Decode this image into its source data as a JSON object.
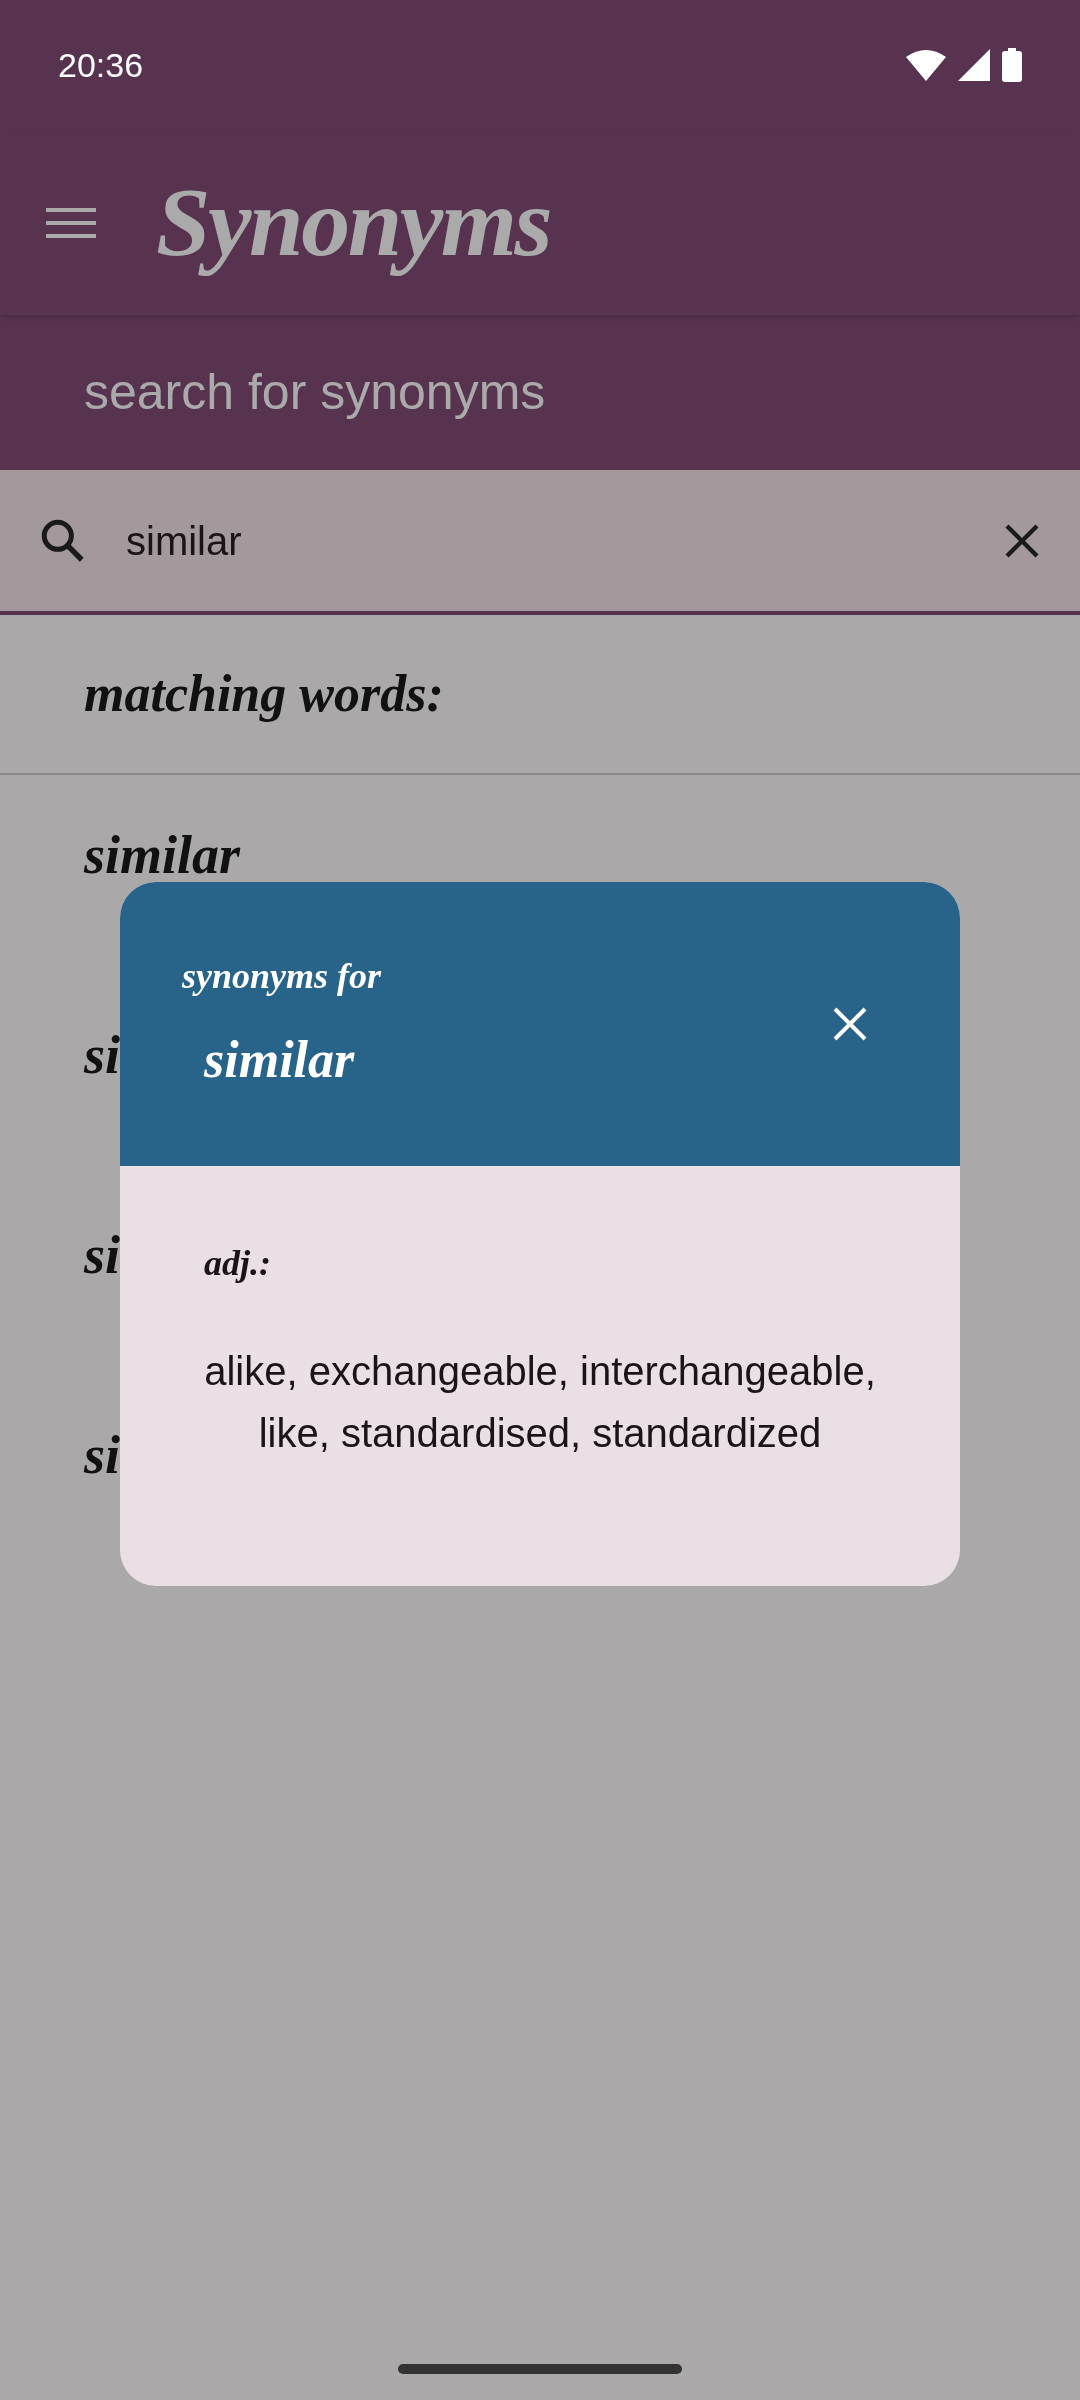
{
  "status_bar": {
    "time": "20:36"
  },
  "app_bar": {
    "title": "Synonyms"
  },
  "subtitle": "search for synonyms",
  "search": {
    "value": "similar"
  },
  "section_heading": "matching words:",
  "results": [
    {
      "text": "similar"
    },
    {
      "text": "si"
    },
    {
      "text": "si"
    },
    {
      "text": "si"
    }
  ],
  "dialog": {
    "caption": "synonyms for",
    "word": "similar",
    "part_of_speech": "adj.:",
    "synonyms": "alike, exchangeable, interchangeable, like, standardised, standardized"
  }
}
